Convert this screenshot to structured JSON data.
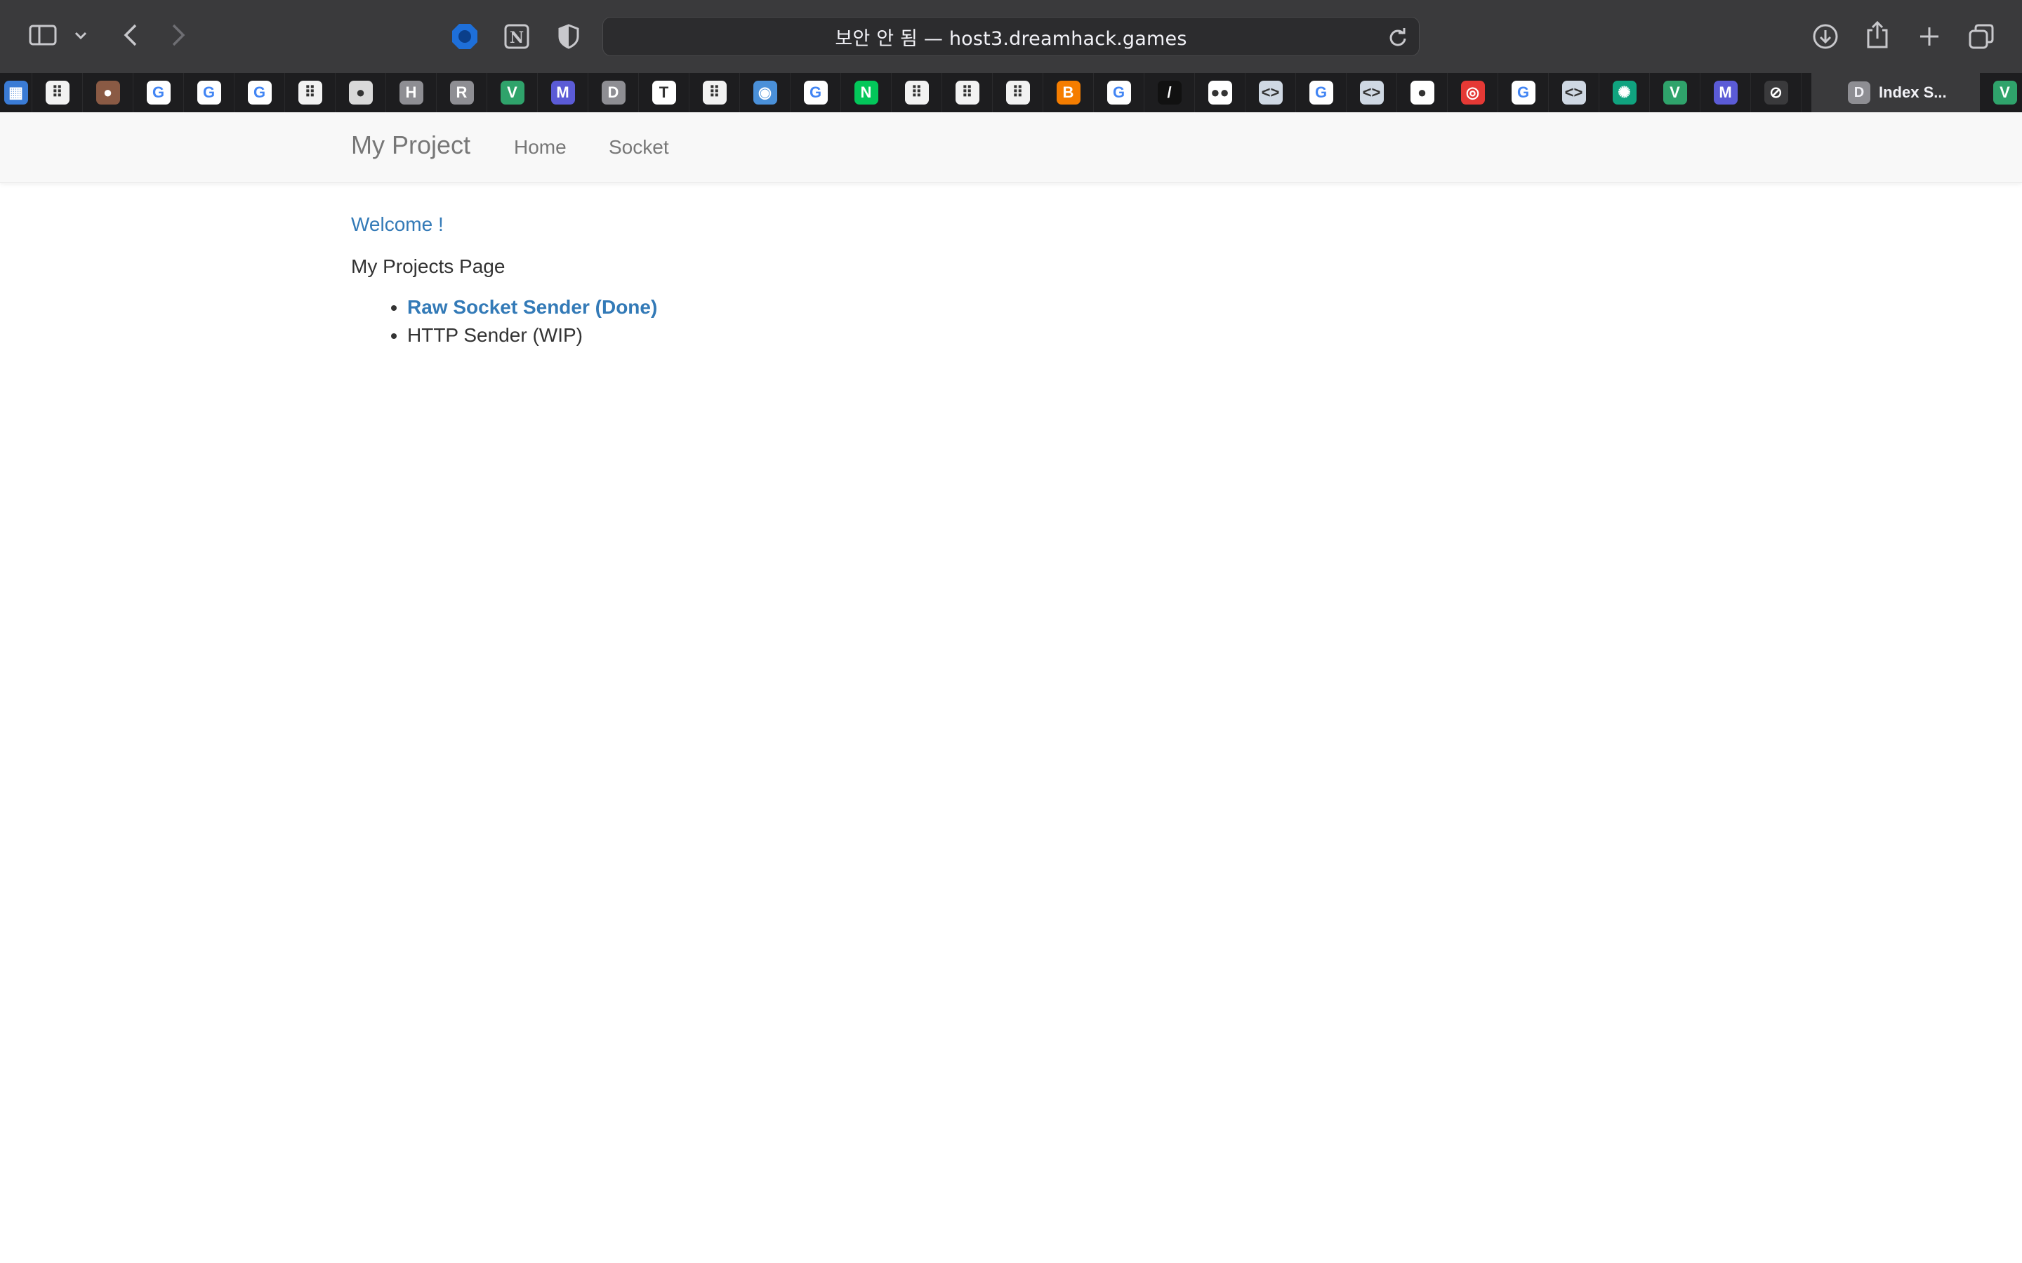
{
  "browser": {
    "address": "보안 안 됨 — host3.dreamhack.games",
    "bookmarks": [
      {
        "icon": "bookmark-grid-icon",
        "bg": "#3a7bd5",
        "glyph": "▦"
      },
      {
        "icon": "bookmark-dots-icon",
        "bg": "#f2f2f2",
        "glyph": "⠿"
      },
      {
        "icon": "bookmark-avatar-icon",
        "bg": "#8a5a44",
        "glyph": "●"
      },
      {
        "icon": "google-icon",
        "bg": "#ffffff",
        "glyph": "G"
      },
      {
        "icon": "google-icon",
        "bg": "#ffffff",
        "glyph": "G"
      },
      {
        "icon": "google-icon",
        "bg": "#ffffff",
        "glyph": "G"
      },
      {
        "icon": "bookmark-dots-icon",
        "bg": "#f2f2f2",
        "glyph": "⠿"
      },
      {
        "icon": "bookmark-penguin-icon",
        "bg": "#d9d9d9",
        "glyph": "●"
      },
      {
        "icon": "bookmark-h-icon",
        "bg": "#8e8e93",
        "glyph": "H"
      },
      {
        "icon": "bookmark-r-icon",
        "bg": "#8e8e93",
        "glyph": "R"
      },
      {
        "icon": "bookmark-v-icon",
        "bg": "#2fa36b",
        "glyph": "V"
      },
      {
        "icon": "bookmark-m-icon",
        "bg": "#5b5bd6",
        "glyph": "M"
      },
      {
        "icon": "bookmark-d-icon",
        "bg": "#8e8e93",
        "glyph": "D"
      },
      {
        "icon": "bookmark-tt-icon",
        "bg": "#ffffff",
        "glyph": "T"
      },
      {
        "icon": "bookmark-dots-icon",
        "bg": "#f2f2f2",
        "glyph": "⠿"
      },
      {
        "icon": "bookmark-globe-icon",
        "bg": "#4a90d9",
        "glyph": "◉"
      },
      {
        "icon": "google-icon",
        "bg": "#ffffff",
        "glyph": "G"
      },
      {
        "icon": "bookmark-n-icon",
        "bg": "#03c75a",
        "glyph": "N"
      },
      {
        "icon": "bookmark-dots-icon",
        "bg": "#f2f2f2",
        "glyph": "⠿"
      },
      {
        "icon": "bookmark-dots-icon",
        "bg": "#f2f2f2",
        "glyph": "⠿"
      },
      {
        "icon": "bookmark-dots-icon",
        "bg": "#f2f2f2",
        "glyph": "⠿"
      },
      {
        "icon": "blogger-icon",
        "bg": "#f57d00",
        "glyph": "B"
      },
      {
        "icon": "google-icon",
        "bg": "#ffffff",
        "glyph": "G"
      },
      {
        "icon": "bookmark-code-icon",
        "bg": "#111111",
        "glyph": "/"
      },
      {
        "icon": "medium-icon",
        "bg": "#ffffff",
        "glyph": "●●"
      },
      {
        "icon": "bookmark-code-icon",
        "bg": "#cfd8e3",
        "glyph": "<>"
      },
      {
        "icon": "google-icon",
        "bg": "#ffffff",
        "glyph": "G"
      },
      {
        "icon": "bookmark-code-icon",
        "bg": "#cfd8e3",
        "glyph": "<>"
      },
      {
        "icon": "github-icon",
        "bg": "#ffffff",
        "glyph": "●"
      },
      {
        "icon": "bookmark-target-icon",
        "bg": "#e53935",
        "glyph": "◎"
      },
      {
        "icon": "google-icon",
        "bg": "#ffffff",
        "glyph": "G"
      },
      {
        "icon": "bookmark-code-icon",
        "bg": "#cfd8e3",
        "glyph": "<>"
      },
      {
        "icon": "openai-icon",
        "bg": "#10a37f",
        "glyph": "✺"
      },
      {
        "icon": "bookmark-v-icon",
        "bg": "#2fa36b",
        "glyph": "V"
      },
      {
        "icon": "bookmark-m-icon",
        "bg": "#5b5bd6",
        "glyph": "M"
      },
      {
        "icon": "compass-icon",
        "bg": "#3a3a3c",
        "glyph": "⊘"
      }
    ],
    "active_tab_label": "Index S...",
    "active_tab_glyph": "D"
  },
  "navbar": {
    "brand": "My Project",
    "links": [
      "Home",
      "Socket"
    ]
  },
  "main": {
    "welcome": "Welcome !",
    "subtitle": "My Projects Page",
    "projects": [
      {
        "label": "Raw Socket Sender (Done)",
        "link": true
      },
      {
        "label": "HTTP Sender (WIP)",
        "link": false
      }
    ]
  },
  "colors": {
    "link": "#337ab7",
    "navbar_bg": "#f8f8f8",
    "chrome_bg": "#3a3a3c"
  }
}
